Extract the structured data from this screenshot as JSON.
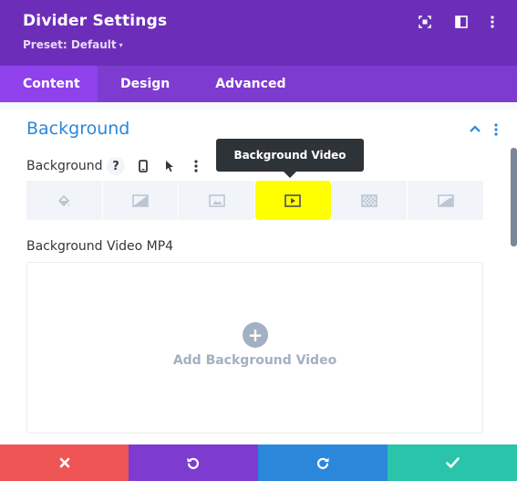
{
  "header": {
    "title": "Divider Settings",
    "preset_label": "Preset: Default",
    "preset_caret": "▾",
    "icons": [
      "expand-icon",
      "sidebar-toggle-icon",
      "more-vertical-icon"
    ]
  },
  "tabs": [
    {
      "label": "Content",
      "active": true
    },
    {
      "label": "Design",
      "active": false
    },
    {
      "label": "Advanced",
      "active": false
    }
  ],
  "section": {
    "title": "Background",
    "field_label": "Background",
    "help_glyph": "?",
    "field_icons": [
      "help-icon",
      "mobile-icon",
      "cursor-icon",
      "more-vertical-icon"
    ],
    "tooltip": "Background Video",
    "bg_types": [
      "paint-bucket-icon",
      "gradient-icon",
      "image-icon",
      "video-icon",
      "pattern-icon",
      "mask-icon"
    ],
    "selected_bg_type": "video-icon",
    "mp4_label": "Background Video MP4",
    "upload_plus": "+",
    "upload_text": "Add Background Video"
  },
  "footer": {
    "buttons": [
      "cancel",
      "undo",
      "redo",
      "save"
    ]
  },
  "colors": {
    "header": "#6c2eb9",
    "tabs": "#7e3bd0",
    "active_tab": "#8f42ec",
    "accent_blue": "#2b87da",
    "highlight": "#ffff00",
    "cancel": "#ef5555",
    "undo": "#7e3bd0",
    "redo": "#2b87da",
    "save": "#29c4a9"
  }
}
